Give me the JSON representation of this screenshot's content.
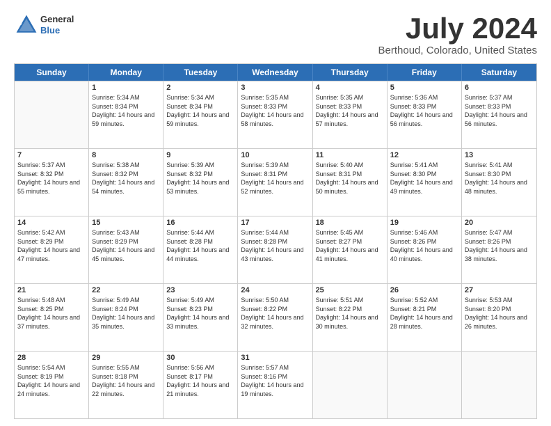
{
  "logo": {
    "line1": "General",
    "line2": "Blue"
  },
  "title": "July 2024",
  "subtitle": "Berthoud, Colorado, United States",
  "header_days": [
    "Sunday",
    "Monday",
    "Tuesday",
    "Wednesday",
    "Thursday",
    "Friday",
    "Saturday"
  ],
  "weeks": [
    [
      {
        "day": "",
        "sunrise": "",
        "sunset": "",
        "daylight": ""
      },
      {
        "day": "1",
        "sunrise": "Sunrise: 5:34 AM",
        "sunset": "Sunset: 8:34 PM",
        "daylight": "Daylight: 14 hours and 59 minutes."
      },
      {
        "day": "2",
        "sunrise": "Sunrise: 5:34 AM",
        "sunset": "Sunset: 8:34 PM",
        "daylight": "Daylight: 14 hours and 59 minutes."
      },
      {
        "day": "3",
        "sunrise": "Sunrise: 5:35 AM",
        "sunset": "Sunset: 8:33 PM",
        "daylight": "Daylight: 14 hours and 58 minutes."
      },
      {
        "day": "4",
        "sunrise": "Sunrise: 5:35 AM",
        "sunset": "Sunset: 8:33 PM",
        "daylight": "Daylight: 14 hours and 57 minutes."
      },
      {
        "day": "5",
        "sunrise": "Sunrise: 5:36 AM",
        "sunset": "Sunset: 8:33 PM",
        "daylight": "Daylight: 14 hours and 56 minutes."
      },
      {
        "day": "6",
        "sunrise": "Sunrise: 5:37 AM",
        "sunset": "Sunset: 8:33 PM",
        "daylight": "Daylight: 14 hours and 56 minutes."
      }
    ],
    [
      {
        "day": "7",
        "sunrise": "Sunrise: 5:37 AM",
        "sunset": "Sunset: 8:32 PM",
        "daylight": "Daylight: 14 hours and 55 minutes."
      },
      {
        "day": "8",
        "sunrise": "Sunrise: 5:38 AM",
        "sunset": "Sunset: 8:32 PM",
        "daylight": "Daylight: 14 hours and 54 minutes."
      },
      {
        "day": "9",
        "sunrise": "Sunrise: 5:39 AM",
        "sunset": "Sunset: 8:32 PM",
        "daylight": "Daylight: 14 hours and 53 minutes."
      },
      {
        "day": "10",
        "sunrise": "Sunrise: 5:39 AM",
        "sunset": "Sunset: 8:31 PM",
        "daylight": "Daylight: 14 hours and 52 minutes."
      },
      {
        "day": "11",
        "sunrise": "Sunrise: 5:40 AM",
        "sunset": "Sunset: 8:31 PM",
        "daylight": "Daylight: 14 hours and 50 minutes."
      },
      {
        "day": "12",
        "sunrise": "Sunrise: 5:41 AM",
        "sunset": "Sunset: 8:30 PM",
        "daylight": "Daylight: 14 hours and 49 minutes."
      },
      {
        "day": "13",
        "sunrise": "Sunrise: 5:41 AM",
        "sunset": "Sunset: 8:30 PM",
        "daylight": "Daylight: 14 hours and 48 minutes."
      }
    ],
    [
      {
        "day": "14",
        "sunrise": "Sunrise: 5:42 AM",
        "sunset": "Sunset: 8:29 PM",
        "daylight": "Daylight: 14 hours and 47 minutes."
      },
      {
        "day": "15",
        "sunrise": "Sunrise: 5:43 AM",
        "sunset": "Sunset: 8:29 PM",
        "daylight": "Daylight: 14 hours and 45 minutes."
      },
      {
        "day": "16",
        "sunrise": "Sunrise: 5:44 AM",
        "sunset": "Sunset: 8:28 PM",
        "daylight": "Daylight: 14 hours and 44 minutes."
      },
      {
        "day": "17",
        "sunrise": "Sunrise: 5:44 AM",
        "sunset": "Sunset: 8:28 PM",
        "daylight": "Daylight: 14 hours and 43 minutes."
      },
      {
        "day": "18",
        "sunrise": "Sunrise: 5:45 AM",
        "sunset": "Sunset: 8:27 PM",
        "daylight": "Daylight: 14 hours and 41 minutes."
      },
      {
        "day": "19",
        "sunrise": "Sunrise: 5:46 AM",
        "sunset": "Sunset: 8:26 PM",
        "daylight": "Daylight: 14 hours and 40 minutes."
      },
      {
        "day": "20",
        "sunrise": "Sunrise: 5:47 AM",
        "sunset": "Sunset: 8:26 PM",
        "daylight": "Daylight: 14 hours and 38 minutes."
      }
    ],
    [
      {
        "day": "21",
        "sunrise": "Sunrise: 5:48 AM",
        "sunset": "Sunset: 8:25 PM",
        "daylight": "Daylight: 14 hours and 37 minutes."
      },
      {
        "day": "22",
        "sunrise": "Sunrise: 5:49 AM",
        "sunset": "Sunset: 8:24 PM",
        "daylight": "Daylight: 14 hours and 35 minutes."
      },
      {
        "day": "23",
        "sunrise": "Sunrise: 5:49 AM",
        "sunset": "Sunset: 8:23 PM",
        "daylight": "Daylight: 14 hours and 33 minutes."
      },
      {
        "day": "24",
        "sunrise": "Sunrise: 5:50 AM",
        "sunset": "Sunset: 8:22 PM",
        "daylight": "Daylight: 14 hours and 32 minutes."
      },
      {
        "day": "25",
        "sunrise": "Sunrise: 5:51 AM",
        "sunset": "Sunset: 8:22 PM",
        "daylight": "Daylight: 14 hours and 30 minutes."
      },
      {
        "day": "26",
        "sunrise": "Sunrise: 5:52 AM",
        "sunset": "Sunset: 8:21 PM",
        "daylight": "Daylight: 14 hours and 28 minutes."
      },
      {
        "day": "27",
        "sunrise": "Sunrise: 5:53 AM",
        "sunset": "Sunset: 8:20 PM",
        "daylight": "Daylight: 14 hours and 26 minutes."
      }
    ],
    [
      {
        "day": "28",
        "sunrise": "Sunrise: 5:54 AM",
        "sunset": "Sunset: 8:19 PM",
        "daylight": "Daylight: 14 hours and 24 minutes."
      },
      {
        "day": "29",
        "sunrise": "Sunrise: 5:55 AM",
        "sunset": "Sunset: 8:18 PM",
        "daylight": "Daylight: 14 hours and 22 minutes."
      },
      {
        "day": "30",
        "sunrise": "Sunrise: 5:56 AM",
        "sunset": "Sunset: 8:17 PM",
        "daylight": "Daylight: 14 hours and 21 minutes."
      },
      {
        "day": "31",
        "sunrise": "Sunrise: 5:57 AM",
        "sunset": "Sunset: 8:16 PM",
        "daylight": "Daylight: 14 hours and 19 minutes."
      },
      {
        "day": "",
        "sunrise": "",
        "sunset": "",
        "daylight": ""
      },
      {
        "day": "",
        "sunrise": "",
        "sunset": "",
        "daylight": ""
      },
      {
        "day": "",
        "sunrise": "",
        "sunset": "",
        "daylight": ""
      }
    ]
  ]
}
